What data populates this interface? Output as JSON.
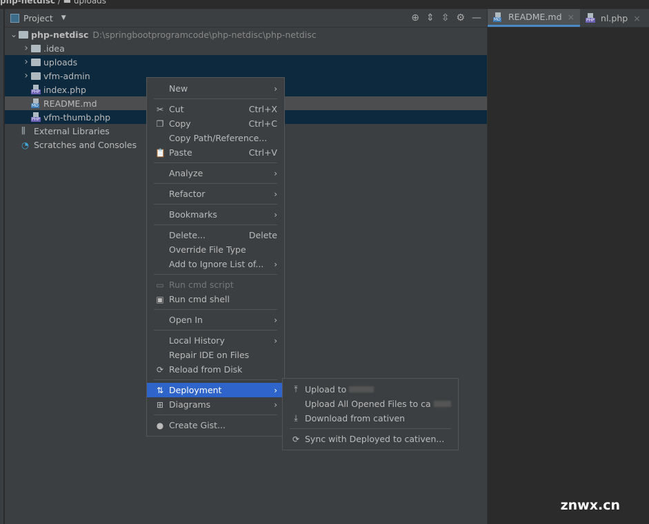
{
  "breadcrumb": {
    "project": "php-netdisc",
    "folder": "uploads"
  },
  "panel": {
    "title": "Project",
    "tools": [
      "locate-icon",
      "expand-all-icon",
      "collapse-all-icon",
      "gear-icon",
      "minimize-icon"
    ]
  },
  "tree": [
    {
      "label": "php-netdisc",
      "path": "D:\\springbootprogramcode\\php-netdisc\\php-netdisc",
      "type": "root",
      "expanded": true,
      "state": ""
    },
    {
      "label": ".idea",
      "type": "folder",
      "state": ""
    },
    {
      "label": "uploads",
      "type": "folder",
      "state": "sel"
    },
    {
      "label": "vfm-admin",
      "type": "folder",
      "state": "sel"
    },
    {
      "label": "index.php",
      "type": "php",
      "state": "sel"
    },
    {
      "label": "README.md",
      "type": "md",
      "state": "focus"
    },
    {
      "label": "vfm-thumb.php",
      "type": "php",
      "state": "sel"
    },
    {
      "label": "External Libraries",
      "type": "libs",
      "state": ""
    },
    {
      "label": "Scratches and Consoles",
      "type": "scratch",
      "state": ""
    }
  ],
  "tabs": [
    {
      "label": "README.md",
      "type": "md",
      "active": true
    },
    {
      "label": "nl.php",
      "type": "php",
      "active": false
    },
    {
      "label": "",
      "type": "php",
      "active": false
    }
  ],
  "menu": [
    {
      "label": "New",
      "sub": true
    },
    {
      "sep": true
    },
    {
      "label": "Cut",
      "icon": "✂",
      "shortcut": "Ctrl+X",
      "iconName": "scissors-icon"
    },
    {
      "label": "Copy",
      "icon": "❐",
      "shortcut": "Ctrl+C",
      "iconName": "copy-icon"
    },
    {
      "label": "Copy Path/Reference..."
    },
    {
      "label": "Paste",
      "icon": "📋",
      "shortcut": "Ctrl+V",
      "iconName": "clipboard-icon"
    },
    {
      "sep": true
    },
    {
      "label": "Analyze",
      "sub": true
    },
    {
      "sep": true
    },
    {
      "label": "Refactor",
      "sub": true
    },
    {
      "sep": true
    },
    {
      "label": "Bookmarks",
      "sub": true
    },
    {
      "sep": true
    },
    {
      "label": "Delete...",
      "shortcut": "Delete"
    },
    {
      "label": "Override File Type"
    },
    {
      "label": "Add to Ignore List of...",
      "sub": true
    },
    {
      "sep": true
    },
    {
      "label": "Run cmd script",
      "icon": "▭",
      "disabled": true,
      "iconName": "cmd-icon"
    },
    {
      "label": "Run cmd shell",
      "icon": "▣",
      "iconName": "cmd-shell-icon"
    },
    {
      "sep": true
    },
    {
      "label": "Open In",
      "sub": true
    },
    {
      "sep": true
    },
    {
      "label": "Local History",
      "sub": true
    },
    {
      "label": "Repair IDE on Files"
    },
    {
      "label": "Reload from Disk",
      "icon": "⟳",
      "iconName": "reload-icon"
    },
    {
      "sep": true
    },
    {
      "label": "Deployment",
      "icon": "⇅",
      "sub": true,
      "highlighted": true,
      "iconName": "deployment-icon"
    },
    {
      "label": "Diagrams",
      "icon": "⊞",
      "sub": true,
      "iconName": "diagram-icon"
    },
    {
      "sep": true
    },
    {
      "label": "Create Gist...",
      "icon": "●",
      "iconName": "github-icon"
    }
  ],
  "submenu": [
    {
      "label": "Upload to",
      "icon": "⤒",
      "iconName": "upload-icon",
      "redacted": true
    },
    {
      "label": "Upload All Opened Files to ca",
      "redacted": true
    },
    {
      "label": "Download from cativen",
      "icon": "⤓",
      "iconName": "download-icon"
    },
    {
      "sep": true
    },
    {
      "label": "Sync with Deployed to cativen...",
      "icon": "⟳",
      "iconName": "sync-icon"
    }
  ],
  "watermark": "znwx.cn",
  "colors": {
    "selection": "#0d293e",
    "highlight": "#2f65ca",
    "php": "#6a5fb5",
    "md": "#3a7ab5"
  }
}
